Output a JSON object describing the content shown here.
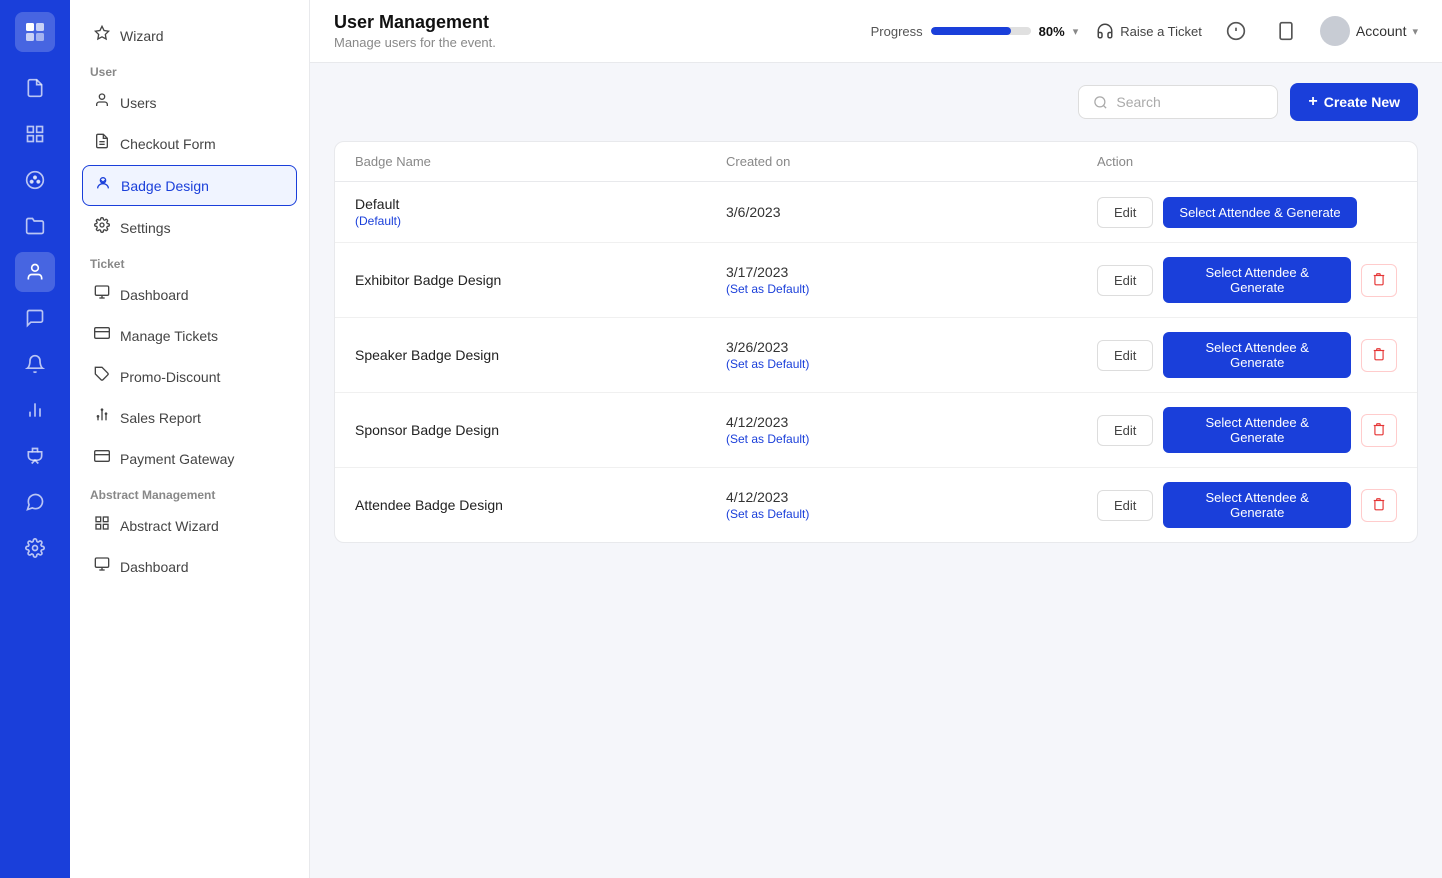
{
  "app": {
    "logo": "≡",
    "title": "User Management",
    "subtitle": "Manage users for the event."
  },
  "header": {
    "progress_label": "Progress",
    "progress_value": 80,
    "progress_pct": "80%",
    "raise_ticket": "Raise a Ticket",
    "account_label": "Account"
  },
  "icon_sidebar": {
    "items": [
      {
        "icon": "📄",
        "name": "document-icon"
      },
      {
        "icon": "⊞",
        "name": "grid-icon"
      },
      {
        "icon": "🎨",
        "name": "palette-icon"
      },
      {
        "icon": "📁",
        "name": "folder-icon"
      },
      {
        "icon": "👤",
        "name": "user-icon",
        "active": true
      },
      {
        "icon": "💬",
        "name": "chat-icon"
      },
      {
        "icon": "🔔",
        "name": "bell-icon"
      },
      {
        "icon": "📊",
        "name": "chart-icon"
      },
      {
        "icon": "🏆",
        "name": "trophy-icon"
      },
      {
        "icon": "💭",
        "name": "message-icon"
      },
      {
        "icon": "⚙️",
        "name": "settings-icon"
      }
    ]
  },
  "sidebar": {
    "wizard_label": "Wizard",
    "user_section": "User",
    "user_items": [
      {
        "label": "Users",
        "icon": "👤",
        "name": "users"
      },
      {
        "label": "Checkout Form",
        "icon": "📄",
        "name": "checkout-form"
      },
      {
        "label": "Badge Design",
        "icon": "🏷️",
        "name": "badge-design",
        "active": true
      },
      {
        "label": "Settings",
        "icon": "⚙️",
        "name": "settings"
      }
    ],
    "ticket_section": "Ticket",
    "ticket_items": [
      {
        "label": "Dashboard",
        "icon": "⊟",
        "name": "ticket-dashboard"
      },
      {
        "label": "Manage Tickets",
        "icon": "🎫",
        "name": "manage-tickets"
      },
      {
        "label": "Promo-Discount",
        "icon": "🏷️",
        "name": "promo-discount"
      },
      {
        "label": "Sales Report",
        "icon": "📈",
        "name": "sales-report"
      },
      {
        "label": "Payment Gateway",
        "icon": "💳",
        "name": "payment-gateway"
      }
    ],
    "abstract_section": "Abstract Management",
    "abstract_items": [
      {
        "label": "Abstract Wizard",
        "icon": "⊞",
        "name": "abstract-wizard"
      },
      {
        "label": "Dashboard",
        "icon": "⊟",
        "name": "abstract-dashboard"
      }
    ]
  },
  "toolbar": {
    "search_placeholder": "Search",
    "create_new_label": "Create New"
  },
  "table": {
    "columns": [
      {
        "key": "badge_name",
        "label": "Badge Name"
      },
      {
        "key": "created_on",
        "label": "Created on"
      },
      {
        "key": "action",
        "label": "Action"
      }
    ],
    "rows": [
      {
        "badge_name": "Default",
        "badge_sublabel": "(Default)",
        "created_date": "3/6/2023",
        "created_sublabel": null,
        "is_default": true,
        "show_delete": false
      },
      {
        "badge_name": "Exhibitor Badge Design",
        "badge_sublabel": null,
        "created_date": "3/17/2023",
        "created_sublabel": "(Set as Default)",
        "is_default": false,
        "show_delete": true
      },
      {
        "badge_name": "Speaker Badge Design",
        "badge_sublabel": null,
        "created_date": "3/26/2023",
        "created_sublabel": "(Set as Default)",
        "is_default": false,
        "show_delete": true
      },
      {
        "badge_name": "Sponsor Badge Design",
        "badge_sublabel": null,
        "created_date": "4/12/2023",
        "created_sublabel": "(Set as Default)",
        "is_default": false,
        "show_delete": true
      },
      {
        "badge_name": "Attendee Badge Design",
        "badge_sublabel": null,
        "created_date": "4/12/2023",
        "created_sublabel": "(Set as Default)",
        "is_default": false,
        "show_delete": true
      }
    ],
    "edit_label": "Edit",
    "generate_label": "Select Attendee & Generate",
    "delete_icon": "🗑"
  }
}
